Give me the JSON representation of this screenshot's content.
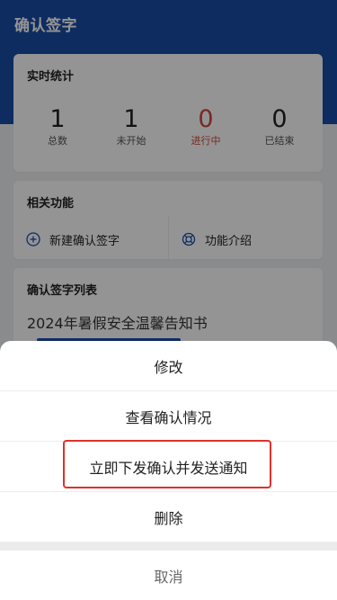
{
  "header": {
    "title": "确认签字"
  },
  "stats": {
    "title": "实时统计",
    "items": [
      {
        "value": "1",
        "label": "总数"
      },
      {
        "value": "1",
        "label": "未开始"
      },
      {
        "value": "0",
        "label": "进行中"
      },
      {
        "value": "0",
        "label": "已结束"
      }
    ]
  },
  "functions": {
    "title": "相关功能",
    "items": [
      {
        "label": "新建确认签字",
        "icon": "add-circle-icon"
      },
      {
        "label": "功能介绍",
        "icon": "lifebuoy-icon"
      }
    ]
  },
  "list": {
    "title": "确认签字列表",
    "items": [
      {
        "title": "2024年暑假安全温馨告知书"
      }
    ]
  },
  "action_sheet": {
    "items": [
      {
        "label": "修改"
      },
      {
        "label": "查看确认情况"
      },
      {
        "label": "立即下发确认并发送通知"
      },
      {
        "label": "删除"
      }
    ],
    "cancel": "取消"
  },
  "colors": {
    "brand": "#1a4ca8",
    "running": "#d0473b",
    "highlight": "#e0302a"
  }
}
